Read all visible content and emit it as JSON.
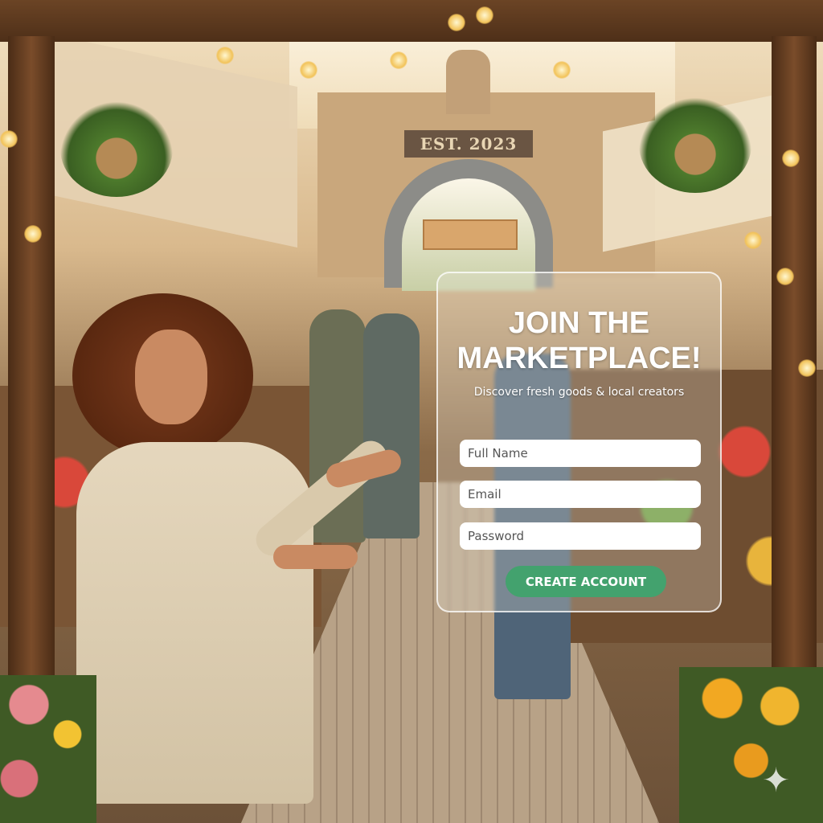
{
  "background": {
    "arch_sign": "EST. 2023"
  },
  "form": {
    "title_line1": "JOIN THE",
    "title_line2": "MARKETPLACE!",
    "subtitle": "Discover fresh goods & local creators",
    "fields": [
      {
        "placeholder": "Full Name",
        "value": ""
      },
      {
        "placeholder": "Email",
        "value": ""
      },
      {
        "placeholder": "Password",
        "value": ""
      }
    ],
    "submit_label": "CREATE ACCOUNT"
  },
  "colors": {
    "accent": "#43a26e"
  }
}
